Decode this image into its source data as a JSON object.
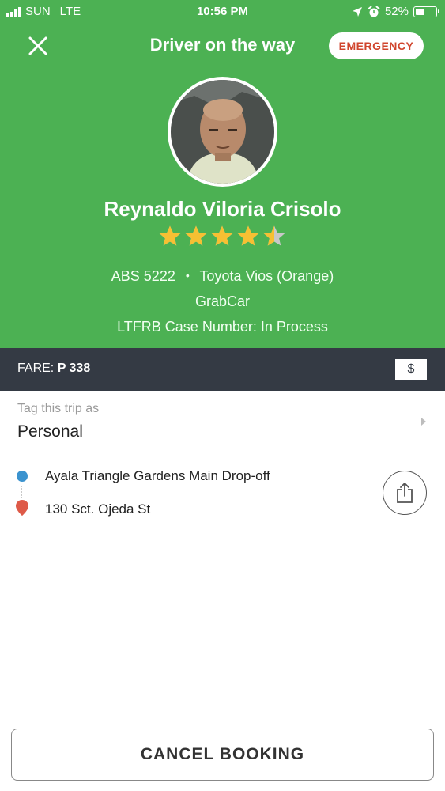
{
  "status_bar": {
    "carrier": "SUN",
    "network": "LTE",
    "time": "10:56 PM",
    "battery": "52%",
    "battery_level": 0.52,
    "icons": [
      "signal-bars-icon",
      "location-arrow-icon",
      "alarm-icon",
      "battery-icon"
    ]
  },
  "header": {
    "title": "Driver on the way",
    "emergency_label": "EMERGENCY",
    "close_icon": "close-icon",
    "background_color": "#4cb153",
    "emergency_color": "#d0452d"
  },
  "driver": {
    "name": "Reynaldo Viloria Crisolo",
    "rating_stars": 4.5,
    "plate": "ABS 5222",
    "separator": "•",
    "vehicle": "Toyota Vios (Orange)",
    "service": "GrabCar",
    "case_number": "LTFRB Case Number: In Process"
  },
  "fare": {
    "label": "FARE:",
    "amount": "P 338",
    "payment_icon": "$"
  },
  "tag": {
    "caption": "Tag this trip as",
    "value": "Personal"
  },
  "route": {
    "pickup": "Ayala Triangle Gardens Main Drop-off",
    "dropoff": "130 Sct. Ojeda St",
    "pickup_color": "#3b93cf",
    "dropoff_color": "#de5a48"
  },
  "actions": {
    "cancel_label": "CANCEL BOOKING"
  }
}
